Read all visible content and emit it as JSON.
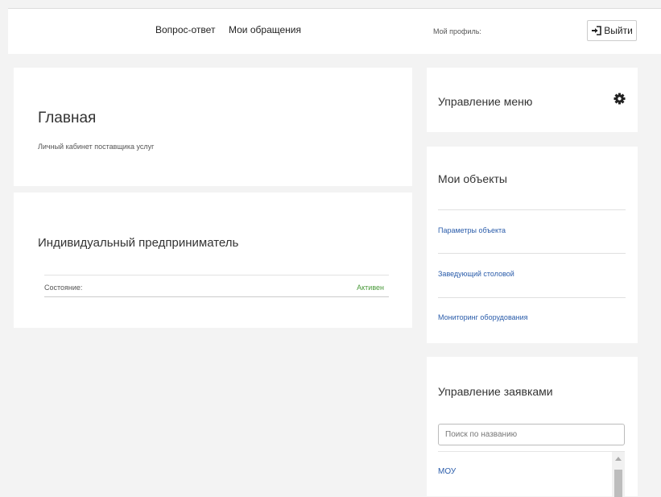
{
  "header": {
    "nav": [
      "Вопрос-ответ",
      "Мои обращения"
    ],
    "profile_label": "Мой профиль:",
    "logout_label": "Выйти"
  },
  "main": {
    "title": "Главная",
    "subtitle": "Личный кабинет поставщика услуг"
  },
  "entity": {
    "title": "Индивидуальный предприниматель",
    "status_label": "Состояние:",
    "status_value": "Активен",
    "status_color": "#4a9a3a"
  },
  "menu_panel": {
    "title": "Управление меню",
    "icon": "gear-icon"
  },
  "objects_panel": {
    "title": "Мои объекты",
    "links": [
      "Параметры объекта",
      "Заведующий столовой",
      "Мониторинг оборудования"
    ]
  },
  "requests_panel": {
    "title": "Управление заявками",
    "search_placeholder": "Поиск по названию",
    "items": [
      "МОУ"
    ]
  },
  "colors": {
    "background": "#f3f3f3",
    "link": "#2a5caa",
    "active": "#4a9a3a"
  }
}
